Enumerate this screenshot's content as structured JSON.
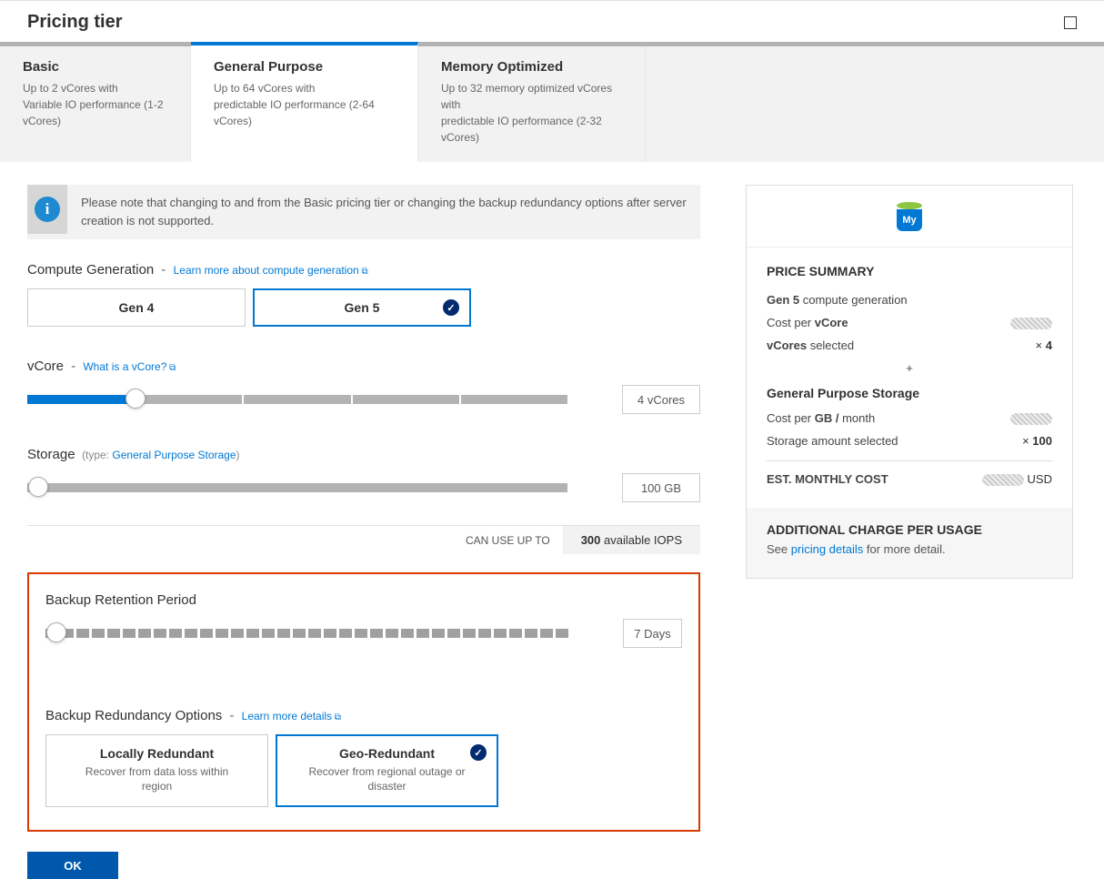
{
  "page_title": "Pricing tier",
  "tabs": {
    "basic": {
      "title": "Basic",
      "line1": "Up to 2 vCores with",
      "line2": "Variable IO performance (1-2 vCores)"
    },
    "general": {
      "title": "General Purpose",
      "line1": "Up to 64 vCores with",
      "line2": "predictable IO performance (2-64 vCores)"
    },
    "memory": {
      "title": "Memory Optimized",
      "line1": "Up to 32 memory optimized vCores with",
      "line2": "predictable IO performance (2-32 vCores)"
    }
  },
  "info_note": "Please note that changing to and from the Basic pricing tier or changing the backup redundancy options after server creation is not supported.",
  "compute": {
    "label": "Compute Generation",
    "link": "Learn more about compute generation",
    "options": {
      "gen4": "Gen 4",
      "gen5": "Gen 5"
    },
    "selected": "gen5"
  },
  "vcore": {
    "label": "vCore",
    "link": "What is a vCore?",
    "value_display": "4 vCores"
  },
  "storage": {
    "label": "Storage",
    "type_prefix": "(type:",
    "type_link": "General Purpose Storage",
    "type_suffix": ")",
    "value_display": "100 GB"
  },
  "iops": {
    "label": "CAN USE UP TO",
    "value_num": "300",
    "value_suffix": " available IOPS"
  },
  "backup": {
    "label": "Backup Retention Period",
    "value_display": "7 Days"
  },
  "redundancy": {
    "label": "Backup Redundancy Options",
    "link": "Learn more details",
    "options": {
      "local": {
        "title": "Locally Redundant",
        "sub": "Recover from data loss within region"
      },
      "geo": {
        "title": "Geo-Redundant",
        "sub": "Recover from regional outage or disaster"
      }
    },
    "selected": "geo"
  },
  "ok_label": "OK",
  "summary": {
    "title": "PRICE SUMMARY",
    "gen_prefix": "Gen 5",
    "gen_suffix": " compute generation",
    "cost_per_vcore_label_a": "Cost per ",
    "cost_per_vcore_label_b": "vCore",
    "vcores_selected_a": "vCores",
    "vcores_selected_b": " selected",
    "vcores_value_prefix": "×   ",
    "vcores_value": "4",
    "gp_storage_title": "General Purpose Storage",
    "cost_per_gb_a": "Cost per ",
    "cost_per_gb_b": "GB / ",
    "cost_per_gb_c": "month",
    "storage_selected": "Storage amount selected",
    "storage_value_prefix": "×   ",
    "storage_value": "100",
    "est_cost": "EST. MONTHLY COST",
    "est_currency": "USD",
    "usage_title": "ADDITIONAL CHARGE PER USAGE",
    "usage_prefix": "See ",
    "usage_link": "pricing details",
    "usage_suffix": " for more detail."
  }
}
